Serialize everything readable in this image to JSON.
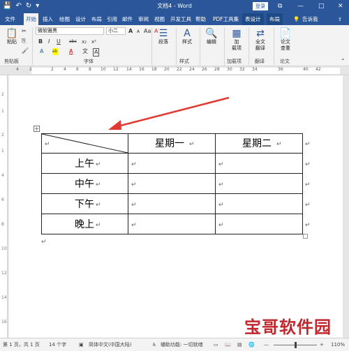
{
  "titlebar": {
    "qat": {
      "save_icon": "💾",
      "undo_icon": "↶",
      "redo_icon": "↻",
      "more_icon": "▾"
    },
    "title": "文档4 - Word",
    "login": "登录",
    "restore_icon": "⧉",
    "minimize_icon": "—",
    "maximize_icon": "□",
    "close_icon": "✕"
  },
  "tabs": {
    "file": "文件",
    "home": "开始",
    "insert": "插入",
    "draw": "绘图",
    "design": "设计",
    "layout": "布局",
    "references": "引用",
    "mailings": "邮件",
    "review": "审阅",
    "view": "视图",
    "developer": "开发工具",
    "help": "帮助",
    "pdf": "PDF工具集",
    "table_design": "表设计",
    "table_layout": "布局",
    "tell_me": "告诉我",
    "lightbulb_icon": "💡",
    "share_icon": "⇪"
  },
  "ribbon": {
    "paste": "粘贴",
    "clipboard": "剪贴板",
    "font_name": "微软雅黑",
    "font_size": "小二",
    "font_group": "字体",
    "paragraph": "段落",
    "styles": "样式",
    "editing": "编辑",
    "addins_button": "加\n载项",
    "addins_group": "加载项",
    "translate_button": "全文\n翻译",
    "translate_group": "翻译",
    "check_button": "论文\n查重",
    "check_group": "论文",
    "bold": "B",
    "italic": "I",
    "underline": "U",
    "strike": "abc",
    "subscript": "x₂",
    "superscript": "x²",
    "font_color": "A",
    "highlight": "ab",
    "clear": "A",
    "grow": "A",
    "shrink": "A",
    "case": "Aa",
    "char_border": "A",
    "wen": "文"
  },
  "ruler_numbers": [
    "4",
    "2",
    "2",
    "4",
    "6",
    "8",
    "10",
    "12",
    "14",
    "16",
    "18",
    "20",
    "22",
    "24",
    "26",
    "28",
    "30",
    "32",
    "34",
    "36",
    "40",
    "42"
  ],
  "vruler_numbers": [
    "2",
    "1",
    "2",
    "1",
    "4",
    "6",
    "8",
    "10",
    "12",
    "14",
    "16"
  ],
  "table": {
    "header": [
      "",
      "星期一",
      "星期二"
    ],
    "rows": [
      [
        "上午",
        "",
        ""
      ],
      [
        "中午",
        "",
        ""
      ],
      [
        "下午",
        "",
        ""
      ],
      [
        "晚上",
        "",
        ""
      ]
    ],
    "para_mark": "↵",
    "arrow_color": "#e23a32",
    "border_color": "#222222"
  },
  "status": {
    "page": "第 1 页，共 1 页",
    "words": "14 个字",
    "language": "简体中文(中国大陆)",
    "accessibility": "辅助功能: 一切就绪",
    "zoom": "110%",
    "focus_icon": "▭",
    "read_icon": "📖",
    "print_icon": "▤",
    "web_icon": "🌐",
    "minus": "—",
    "plus": "+"
  },
  "watermark": "宝哥软件园",
  "colors": {
    "accent": "#2b579a",
    "watermark": "#c1272d"
  }
}
